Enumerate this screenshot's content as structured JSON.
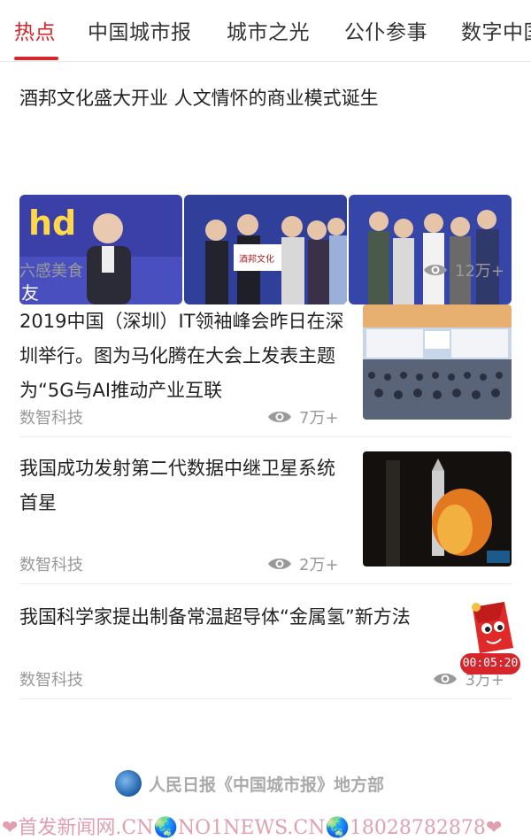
{
  "tabs": [
    {
      "label": "热点",
      "active": true
    },
    {
      "label": "中国城市报",
      "active": false
    },
    {
      "label": "城市之光",
      "active": false
    },
    {
      "label": "公仆参事",
      "active": false
    },
    {
      "label": "数字中国",
      "active": false
    }
  ],
  "feed": [
    {
      "title": "酒邦文化盛大开业 人文情怀的商业模式诞生",
      "source": "六感美食",
      "views": "12万+"
    },
    {
      "title": "2019中国（深圳）IT领袖峰会昨日在深圳举行。图为马化腾在大会上发表主题为“5G与AI推动产业互联",
      "source": "数智科技",
      "views": "7万+"
    },
    {
      "title": "我国成功发射第二代数据中继卫星系统首星",
      "source": "数智科技",
      "views": "2万+"
    },
    {
      "title": "我国科学家提出制备常温超导体“金属氢”新方法",
      "source": "数智科技",
      "views": "3万+"
    }
  ],
  "float_timer": "00:05:20",
  "footer_source": "人民日报《中国城市报》地方部",
  "watermark": "❤首发新闻网.CN🌏NO1NEWS.CN🌏18028782878❤",
  "icons": {
    "views": "eye-icon",
    "footer": "globe-icon",
    "float": "red-envelope-icon"
  },
  "colors": {
    "accent": "#d7262b",
    "meta": "#999999"
  }
}
